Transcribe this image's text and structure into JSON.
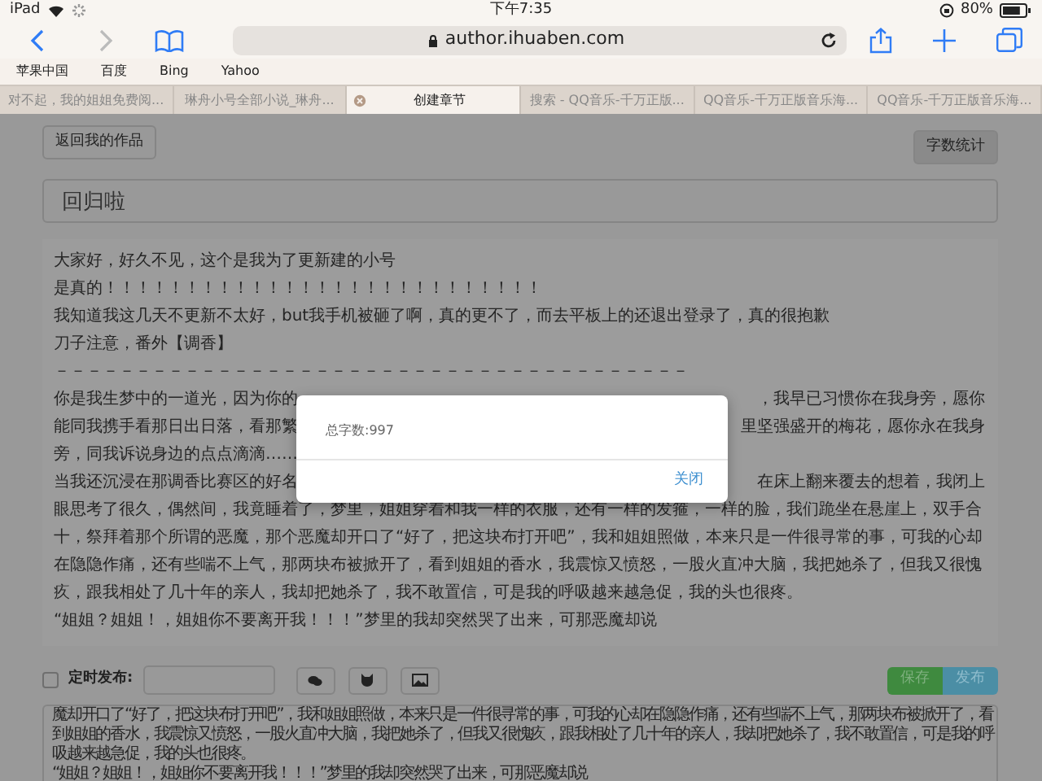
{
  "status_bar": {
    "device": "iPad",
    "time": "下午7:35",
    "battery": "80%"
  },
  "toolbar": {
    "back_disabled": false,
    "forward_disabled": true,
    "url": "author.ihuaben.com"
  },
  "bookmarks": [
    "苹果中国",
    "百度",
    "Bing",
    "Yahoo"
  ],
  "tabs": [
    {
      "label": "对不起，我的姐姐免费阅...",
      "selected": false
    },
    {
      "label": "琳舟小号全部小说_琳舟...",
      "selected": false
    },
    {
      "label": "创建章节",
      "selected": true
    },
    {
      "label": "搜索 - QQ音乐-千万正版...",
      "selected": false
    },
    {
      "label": "QQ音乐-千万正版音乐海...",
      "selected": false
    },
    {
      "label": "QQ音乐-千万正版音乐海...",
      "selected": false
    }
  ],
  "page": {
    "back_button": "返回我的作品",
    "word_count_button": "字数统计",
    "title_value": "回归啦",
    "editor_lines": [
      {
        "kind": "full",
        "text": "大家好，好久不见，这个是我为了更新建的小号"
      },
      {
        "kind": "full",
        "text": "是真的！！！！！！！！！！！！！！！！！！！！！！！！！！！"
      },
      {
        "kind": "full",
        "text": "我知道我这几天不更新不太好，but我手机被砸了啊，真的更不了，而去平板上的还退出登录了，真的很抱歉"
      },
      {
        "kind": "full",
        "text": "刀子注意，番外【调香】"
      },
      {
        "kind": "full",
        "text": "－－－－－－－－－－－－－－－－－－－－－－－－－－－－－－－－－－－－－－－"
      },
      {
        "kind": "split",
        "left": "你是我生梦中的一道光，因为你的",
        "right": "，我早已习惯你在我身旁，愿你"
      },
      {
        "kind": "split",
        "left": "能同我携手看那日出日落，看那繁",
        "right": "里坚强盛开的梅花，愿你永在我身"
      },
      {
        "kind": "full",
        "text": "旁，同我诉说身边的点点滴滴……"
      },
      {
        "kind": "split",
        "left": "当我还沉浸在那调香比赛区的好名",
        "right": "在床上翻来覆去的想着，我闭上"
      },
      {
        "kind": "full",
        "text": "眼思考了很久，偶然间，我竟睡着了，梦里，姐姐穿着和我一样的衣服，还有一样的发箍，一样的脸，我们跪坐在悬崖上，双手合"
      },
      {
        "kind": "full",
        "text": "十，祭拜着那个所谓的恶魔，那个恶魔却开口了“好了，把这块布打开吧”，我和姐姐照做，本来只是一件很寻常的事，可我的心却"
      },
      {
        "kind": "full",
        "text": "在隐隐作痛，还有些喘不上气，那两块布被掀开了，看到姐姐的香水，我震惊又愤怒，一股火直冲大脑，我把她杀了，但我又很愧"
      },
      {
        "kind": "full",
        "text": "疚，跟我相处了几十年的亲人，我却把她杀了，我不敢置信，可是我的呼吸越来越急促，我的头也很疼。"
      },
      {
        "kind": "full",
        "text": "“姐姐？姐姐！，姐姐你不要离开我！！！”梦里的我却突然哭了出来，可那恶魔却说"
      }
    ],
    "schedule": {
      "checked": false,
      "label": "定时发布:"
    },
    "save_button": "保存",
    "publish_button": "发布",
    "content_lines": [
      "魔却开口了“好了，把这块布打开吧”，我和姐姐照做，本来只是一件很寻常的事，可我的心却在隐隐作痛，还有些喘不上气，那两块布被掀开了，看",
      "到姐姐的香水，我震惊又愤怒，一股火直冲大脑，我把她杀了，但我又很愧疚，跟我相处了几十年的亲人，我却把她杀了，我不敢置信，可是我的呼",
      "吸越来越急促，我的头也很疼。",
      "“姐姐？姐姐！，姐姐你不要离开我！！！”梦里的我却突然哭了出来，可那恶魔却说"
    ]
  },
  "dialog": {
    "message": "总字数:997",
    "close_button": "关闭"
  }
}
